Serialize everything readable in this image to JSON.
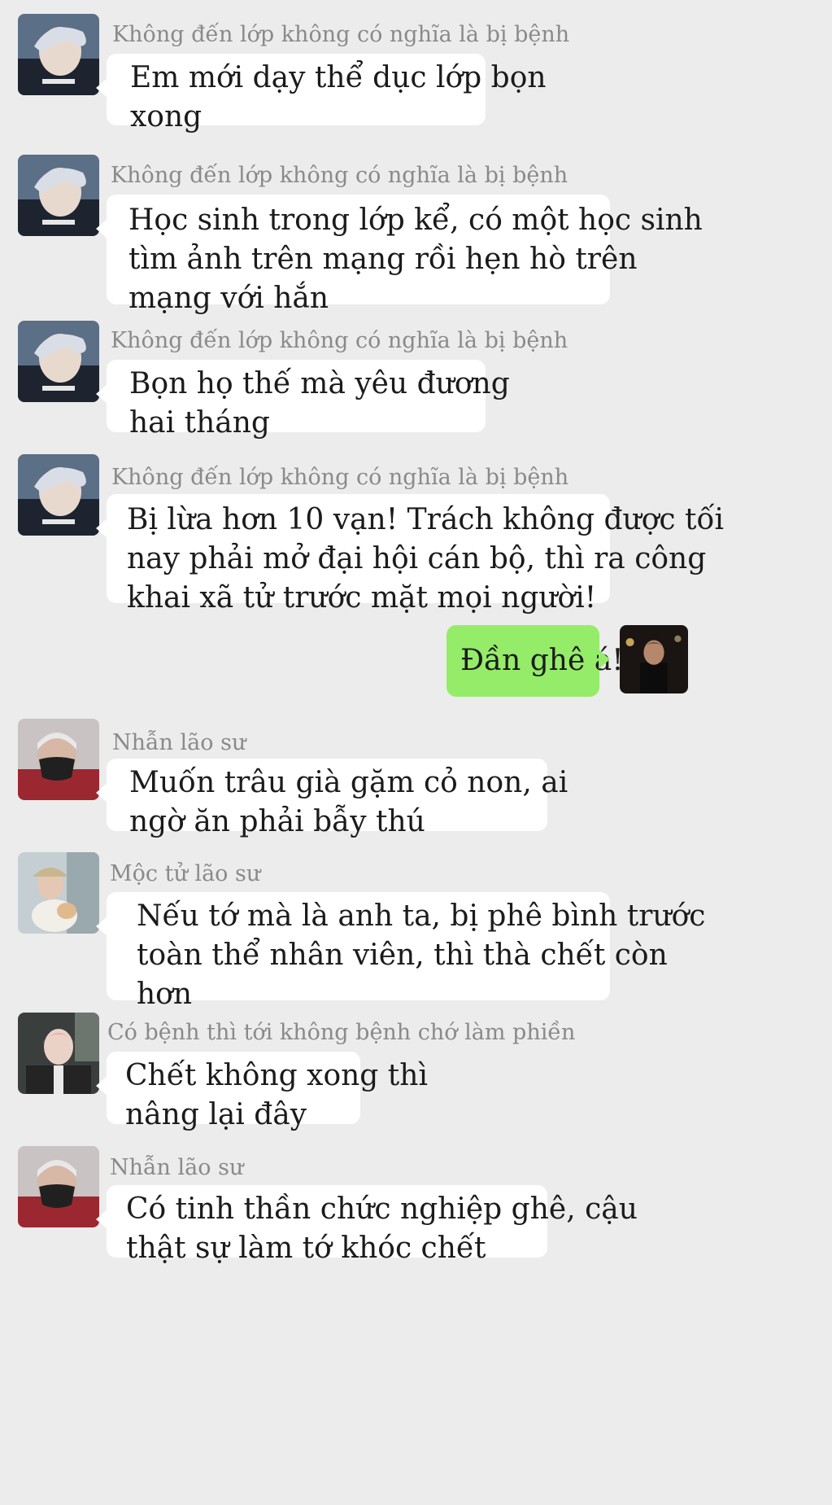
{
  "messages": [
    {
      "sender": "Không đến lớp không có nghĩa là bị bệnh",
      "lines": [
        "Em mới dạy thể dục lớp bọn",
        "xong"
      ]
    },
    {
      "sender": "Không đến lớp không có nghĩa là bị bệnh",
      "lines": [
        "Học sinh trong lớp kể, có một học sinh",
        "tìm ảnh trên mạng rồi hẹn hò trên",
        "mạng với hắn"
      ]
    },
    {
      "sender": "Không đến lớp không có nghĩa là bị bệnh",
      "lines": [
        "Bọn họ thế mà yêu đương",
        "hai tháng"
      ]
    },
    {
      "sender": "Không đến lớp không có nghĩa là bị bệnh",
      "lines": [
        "Bị lừa hơn 10 vạn! Trách không được tối",
        "nay phải mở đại hội cán bộ, thì ra công",
        "khai xã tử trước mặt mọi người!"
      ]
    },
    {
      "sender": "",
      "mine": true,
      "lines": [
        "Đần ghê á!"
      ]
    },
    {
      "sender": "Nhẫn lão sư",
      "lines": [
        "Muốn trâu già gặm cỏ non, ai",
        "ngờ ăn phải bẫy thú"
      ]
    },
    {
      "sender": "Mộc tử lão sư",
      "lines": [
        "Nếu tớ mà là anh ta, bị phê bình trước",
        "toàn thể nhân viên, thì thà chết còn",
        "hơn"
      ]
    },
    {
      "sender": "Có bệnh thì tới không bệnh chớ làm phiền",
      "lines": [
        "Chết không xong thì",
        "nâng lại đây"
      ]
    },
    {
      "sender": "Nhẫn lão sư",
      "lines": [
        "Có tinh thần chức nghiệp ghê, cậu",
        "thật sự làm tớ khóc chết"
      ]
    }
  ],
  "colors": {
    "background": "#ececec",
    "bubble_other": "#ffffff",
    "bubble_mine": "#95ec69",
    "sender_text": "#8a8a8a"
  },
  "icons": {
    "avatar_teacher_1": "avatar-silver-hair",
    "avatar_me": "avatar-night-portrait",
    "avatar_nhan": "avatar-masked-face",
    "avatar_moc": "avatar-cat-hat",
    "avatar_co_benh": "avatar-pink-hair"
  }
}
